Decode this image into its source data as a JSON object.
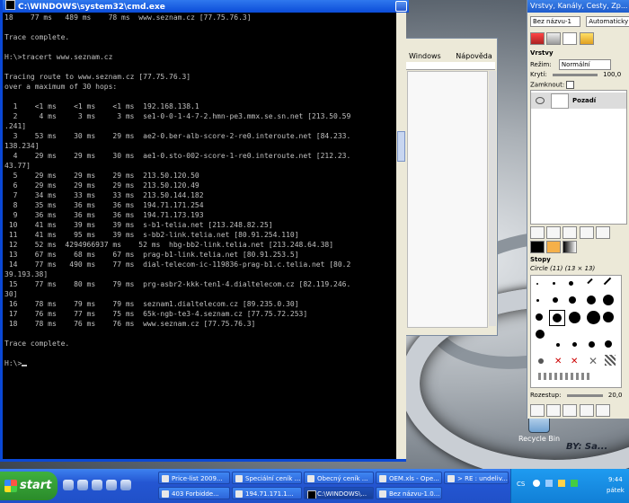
{
  "cmd": {
    "title": "C:\\WINDOWS\\system32\\cmd.exe",
    "lines": [
      "18    77 ms   489 ms    78 ms  www.seznam.cz [77.75.76.3]",
      "",
      "Trace complete.",
      "",
      "H:\\>tracert www.seznam.cz",
      "",
      "Tracing route to www.seznam.cz [77.75.76.3]",
      "over a maximum of 30 hops:",
      "",
      "  1    <1 ms    <1 ms    <1 ms  192.168.138.1",
      "  2     4 ms     3 ms     3 ms  se1-0-0-1-4-7-2.hmn-pe3.mmx.se.sn.net [213.50.59",
      ".241]",
      "  3    53 ms    30 ms    29 ms  ae2-0.ber-alb-score-2-re0.interoute.net [84.233.",
      "138.234]",
      "  4    29 ms    29 ms    30 ms  ae1-0.sto-002-score-1-re0.interoute.net [212.23.",
      "43.77]",
      "  5    29 ms    29 ms    29 ms  213.50.120.50",
      "  6    29 ms    29 ms    29 ms  213.50.120.49",
      "  7    34 ms    33 ms    33 ms  213.50.144.182",
      "  8    35 ms    36 ms    36 ms  194.71.171.254",
      "  9    36 ms    36 ms    36 ms  194.71.173.193",
      " 10    41 ms    39 ms    39 ms  s-b1-telia.net [213.248.82.25]",
      " 11    41 ms    95 ms    39 ms  s-bb2-link.telia.net [80.91.254.110]",
      " 12    52 ms  4294966937 ms    52 ms  hbg-bb2-link.telia.net [213.248.64.38]",
      " 13    67 ms    68 ms    67 ms  prag-b1-link.telia.net [80.91.253.5]",
      " 14    77 ms   490 ms    77 ms  dial-telecom-ic-119836-prag-b1.c.telia.net [80.2",
      "39.193.38]",
      " 15    77 ms    80 ms    79 ms  prg-asbr2-kkk-ten1-4.dialtelecom.cz [82.119.246.",
      "30]",
      " 16    78 ms    79 ms    79 ms  seznam1.dialtelecom.cz [89.235.0.30]",
      " 17    76 ms    77 ms    75 ms  65k-ngb-te3-4.seznam.cz [77.75.72.253]",
      " 18    78 ms    76 ms    76 ms  www.seznam.cz [77.75.76.3]",
      "",
      "Trace complete.",
      "",
      "H:\\>"
    ]
  },
  "gimp_image": {
    "menu": [
      "Windows",
      "Nápověda"
    ]
  },
  "dock": {
    "title": "Vrstvy, Kanály, Cesty, Zp...",
    "image_select": "Bez názvu-1",
    "auto_button": "Automaticky",
    "layers_heading": "Vrstvy",
    "mode_label": "Režim:",
    "mode_value": "Normální",
    "opacity_label": "Krytí:",
    "opacity_value": "100,0",
    "lock_label": "Zamknout:",
    "layer_name": "Pozadí",
    "brushes_heading": "Stopy",
    "brush_name": "Circle (11) (13 × 13)",
    "spacing_label": "Rozestup:",
    "spacing_value": "20,0"
  },
  "desktop": {
    "recycle_label": "Recycle Bin",
    "logo_text": "BY: Sa..."
  },
  "taskbar": {
    "start_label": "start",
    "buttons_top": [
      "Price-list 2009...",
      "Speciální ceník ...",
      "Obecný ceník ...",
      "OEM.xls - Ope...",
      "> RE : undeliv..."
    ],
    "buttons_bottom": [
      "403 Forbidde...",
      "194.71.171.1...",
      "C:\\WINDOWS\\...",
      "Bez názvu-1.0..."
    ],
    "tray_lang": "CS",
    "time": "9:44",
    "day": "pátek"
  }
}
